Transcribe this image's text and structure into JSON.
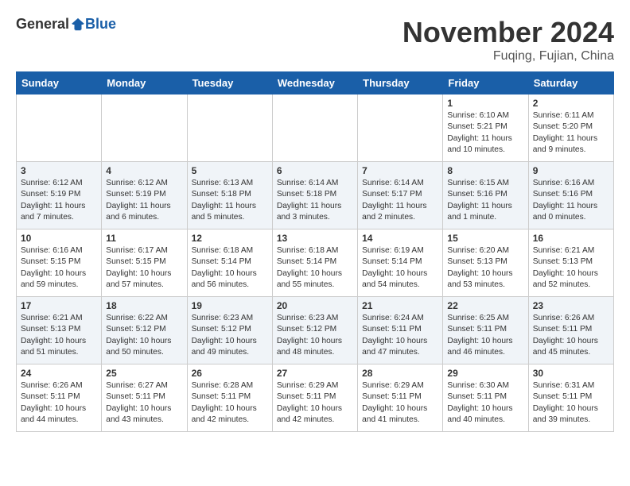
{
  "header": {
    "logo_general": "General",
    "logo_blue": "Blue",
    "month_title": "November 2024",
    "location": "Fuqing, Fujian, China"
  },
  "weekdays": [
    "Sunday",
    "Monday",
    "Tuesday",
    "Wednesday",
    "Thursday",
    "Friday",
    "Saturday"
  ],
  "weeks": [
    {
      "row": 1,
      "days": [
        {
          "num": "",
          "info": ""
        },
        {
          "num": "",
          "info": ""
        },
        {
          "num": "",
          "info": ""
        },
        {
          "num": "",
          "info": ""
        },
        {
          "num": "",
          "info": ""
        },
        {
          "num": "1",
          "info": "Sunrise: 6:10 AM\nSunset: 5:21 PM\nDaylight: 11 hours and 10 minutes."
        },
        {
          "num": "2",
          "info": "Sunrise: 6:11 AM\nSunset: 5:20 PM\nDaylight: 11 hours and 9 minutes."
        }
      ]
    },
    {
      "row": 2,
      "days": [
        {
          "num": "3",
          "info": "Sunrise: 6:12 AM\nSunset: 5:19 PM\nDaylight: 11 hours and 7 minutes."
        },
        {
          "num": "4",
          "info": "Sunrise: 6:12 AM\nSunset: 5:19 PM\nDaylight: 11 hours and 6 minutes."
        },
        {
          "num": "5",
          "info": "Sunrise: 6:13 AM\nSunset: 5:18 PM\nDaylight: 11 hours and 5 minutes."
        },
        {
          "num": "6",
          "info": "Sunrise: 6:14 AM\nSunset: 5:18 PM\nDaylight: 11 hours and 3 minutes."
        },
        {
          "num": "7",
          "info": "Sunrise: 6:14 AM\nSunset: 5:17 PM\nDaylight: 11 hours and 2 minutes."
        },
        {
          "num": "8",
          "info": "Sunrise: 6:15 AM\nSunset: 5:16 PM\nDaylight: 11 hours and 1 minute."
        },
        {
          "num": "9",
          "info": "Sunrise: 6:16 AM\nSunset: 5:16 PM\nDaylight: 11 hours and 0 minutes."
        }
      ]
    },
    {
      "row": 3,
      "days": [
        {
          "num": "10",
          "info": "Sunrise: 6:16 AM\nSunset: 5:15 PM\nDaylight: 10 hours and 59 minutes."
        },
        {
          "num": "11",
          "info": "Sunrise: 6:17 AM\nSunset: 5:15 PM\nDaylight: 10 hours and 57 minutes."
        },
        {
          "num": "12",
          "info": "Sunrise: 6:18 AM\nSunset: 5:14 PM\nDaylight: 10 hours and 56 minutes."
        },
        {
          "num": "13",
          "info": "Sunrise: 6:18 AM\nSunset: 5:14 PM\nDaylight: 10 hours and 55 minutes."
        },
        {
          "num": "14",
          "info": "Sunrise: 6:19 AM\nSunset: 5:14 PM\nDaylight: 10 hours and 54 minutes."
        },
        {
          "num": "15",
          "info": "Sunrise: 6:20 AM\nSunset: 5:13 PM\nDaylight: 10 hours and 53 minutes."
        },
        {
          "num": "16",
          "info": "Sunrise: 6:21 AM\nSunset: 5:13 PM\nDaylight: 10 hours and 52 minutes."
        }
      ]
    },
    {
      "row": 4,
      "days": [
        {
          "num": "17",
          "info": "Sunrise: 6:21 AM\nSunset: 5:13 PM\nDaylight: 10 hours and 51 minutes."
        },
        {
          "num": "18",
          "info": "Sunrise: 6:22 AM\nSunset: 5:12 PM\nDaylight: 10 hours and 50 minutes."
        },
        {
          "num": "19",
          "info": "Sunrise: 6:23 AM\nSunset: 5:12 PM\nDaylight: 10 hours and 49 minutes."
        },
        {
          "num": "20",
          "info": "Sunrise: 6:23 AM\nSunset: 5:12 PM\nDaylight: 10 hours and 48 minutes."
        },
        {
          "num": "21",
          "info": "Sunrise: 6:24 AM\nSunset: 5:11 PM\nDaylight: 10 hours and 47 minutes."
        },
        {
          "num": "22",
          "info": "Sunrise: 6:25 AM\nSunset: 5:11 PM\nDaylight: 10 hours and 46 minutes."
        },
        {
          "num": "23",
          "info": "Sunrise: 6:26 AM\nSunset: 5:11 PM\nDaylight: 10 hours and 45 minutes."
        }
      ]
    },
    {
      "row": 5,
      "days": [
        {
          "num": "24",
          "info": "Sunrise: 6:26 AM\nSunset: 5:11 PM\nDaylight: 10 hours and 44 minutes."
        },
        {
          "num": "25",
          "info": "Sunrise: 6:27 AM\nSunset: 5:11 PM\nDaylight: 10 hours and 43 minutes."
        },
        {
          "num": "26",
          "info": "Sunrise: 6:28 AM\nSunset: 5:11 PM\nDaylight: 10 hours and 42 minutes."
        },
        {
          "num": "27",
          "info": "Sunrise: 6:29 AM\nSunset: 5:11 PM\nDaylight: 10 hours and 42 minutes."
        },
        {
          "num": "28",
          "info": "Sunrise: 6:29 AM\nSunset: 5:11 PM\nDaylight: 10 hours and 41 minutes."
        },
        {
          "num": "29",
          "info": "Sunrise: 6:30 AM\nSunset: 5:11 PM\nDaylight: 10 hours and 40 minutes."
        },
        {
          "num": "30",
          "info": "Sunrise: 6:31 AM\nSunset: 5:11 PM\nDaylight: 10 hours and 39 minutes."
        }
      ]
    }
  ]
}
